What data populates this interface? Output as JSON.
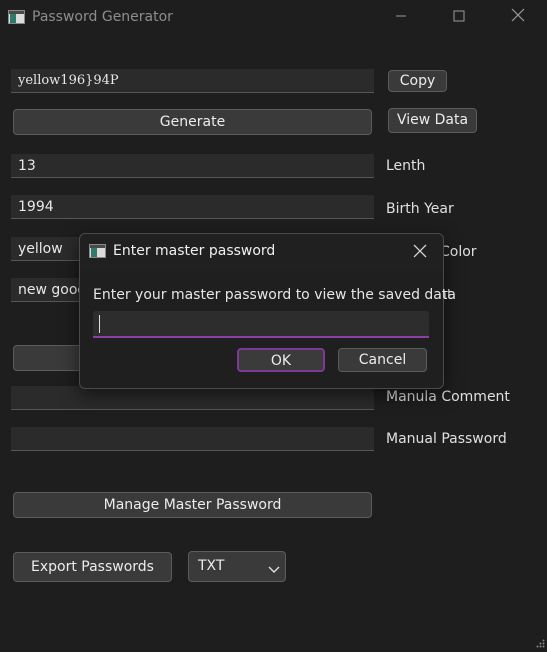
{
  "window": {
    "title": "Password Generator",
    "minimize_icon": "minimize-icon",
    "maximize_icon": "maximize-icon",
    "close_icon": "close-icon"
  },
  "generator": {
    "password_value": "yellow196}94P",
    "copy_label": "Copy",
    "generate_label": "Generate",
    "view_data_label": "View Data"
  },
  "form": {
    "length_value": "13",
    "length_label": "Lenth",
    "birth_year_value": "1994",
    "birth_year_label": "Birth Year",
    "color_value": "yellow",
    "color_label": "Color",
    "comment_value": "new goog",
    "comment_label": "nt",
    "manual_comment_value": "",
    "manual_comment_label": "Manula Comment",
    "manual_password_value": "",
    "manual_password_label": "Manual Password"
  },
  "actions": {
    "manage_master_label": "Manage Master Password",
    "export_label": "Export Passwords",
    "format_selected": "TXT"
  },
  "dialog": {
    "title": "Enter master password",
    "prompt": "Enter your master password to view the saved data",
    "input_value": "",
    "ok_label": "OK",
    "cancel_label": "Cancel"
  },
  "colors": {
    "background": "#1e1e1e",
    "field": "#2b2b2b",
    "accent": "#8a3fa6"
  }
}
